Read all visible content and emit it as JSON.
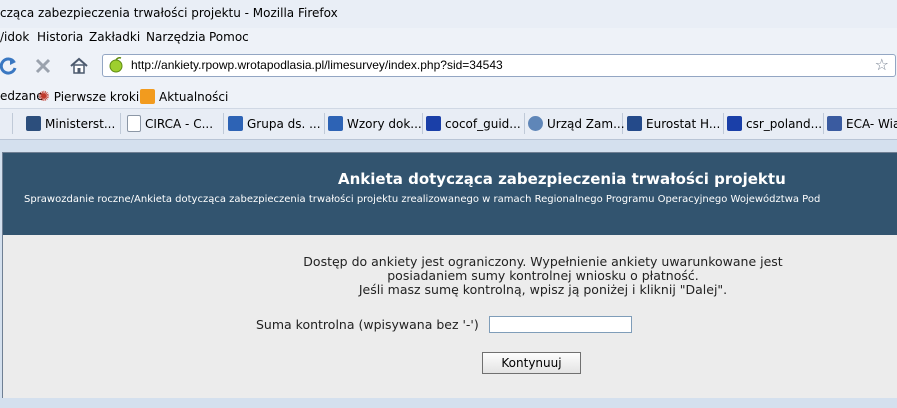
{
  "window": {
    "title": "cząca zabezpieczenia trwałości projektu - Mozilla Firefox"
  },
  "menu": {
    "items": [
      "/idok",
      "Historia",
      "Zakładki",
      "Narzędzia",
      "Pomoc"
    ]
  },
  "url": "http://ankiety.rpowp.wrotapodlasia.pl/limesurvey/index.php?sid=34543",
  "bookmarks_row1": [
    "edzane",
    "Pierwsze kroki",
    "Aktualności"
  ],
  "bookmarks_row2": [
    "",
    "Ministerst...",
    "CIRCA - C...",
    "Grupa ds. ...",
    "Wzory dok...",
    "cocof_guid...",
    "Urząd Zam...",
    "Eurostat H...",
    "csr_poland...",
    "ECA- Wia"
  ],
  "survey": {
    "title": "Ankieta dotycząca zabezpieczenia trwałości projektu",
    "subtitle": "Sprawozdanie roczne/Ankieta dotycząca zabezpieczenia trwałości projektu zrealizowanego w ramach Regionalnego Programu Operacyjnego Województwa Pod",
    "message_line1": "Dostęp do ankiety jest ograniczony. Wypełnienie ankiety uwarunkowane jest",
    "message_line2": "posiadaniem sumy kontrolnej wniosku o płatność.",
    "message_line3": "Jeśli masz sumę kontrolną, wpisz ją poniżej i kliknij \"Dalej\".",
    "checksum_label": "Suma kontrolna (wpisywana bez '-')",
    "checksum_value": "",
    "continue_label": "Kontynuuj"
  },
  "colors": {
    "header_bg": "#32546f",
    "page_bg": "#ececec"
  }
}
